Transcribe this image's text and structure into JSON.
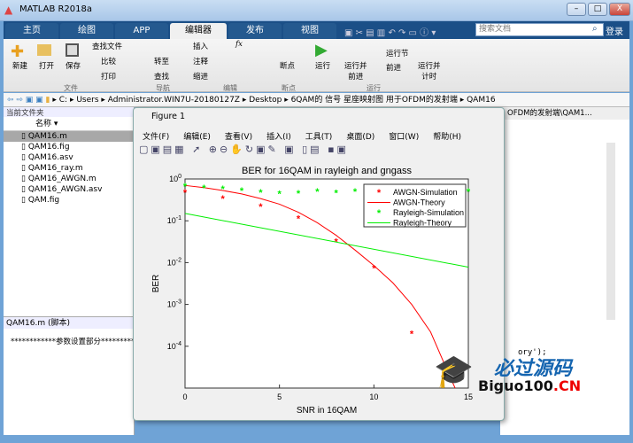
{
  "window": {
    "title": "MATLAB R2018a",
    "min": "–",
    "max": "□",
    "close": "X"
  },
  "tabs": [
    {
      "label": "主页"
    },
    {
      "label": "绘图"
    },
    {
      "label": "APP"
    },
    {
      "label": "编辑器"
    },
    {
      "label": "发布"
    },
    {
      "label": "视图"
    }
  ],
  "search": {
    "placeholder": "搜索文档"
  },
  "login": "登录",
  "ribbon": {
    "new": "新建",
    "open": "打开",
    "save": "保存",
    "find_files": "查找文件",
    "compare": "比较",
    "print": "打印",
    "goto": "转至",
    "find": "查找",
    "insert": "插入",
    "comment": "注释",
    "indent": "缩进",
    "fx": "fx",
    "breakpoints": "断点",
    "run": "运行",
    "run_advance": "运行并\n前进",
    "run_section": "运行节",
    "advance": "前进",
    "run_time": "运行并\n计时",
    "groups": {
      "file": "文件",
      "nav": "导航",
      "edit": "编辑",
      "bp": "断点",
      "run": "运行"
    }
  },
  "address": {
    "path": [
      "C:",
      "Users",
      "Administrator.WIN7U-20180127Z",
      "Desktop",
      "6QAM的 信号 星座映射图 用于OFDM的发射端",
      "QAM16"
    ]
  },
  "current_folder": {
    "title": "当前文件夹",
    "column": "名称",
    "files": [
      {
        "name": "QAM16.m",
        "selected": true
      },
      {
        "name": "QAM16.fig"
      },
      {
        "name": "QAM16.asv"
      },
      {
        "name": "QAM16_ray.m"
      },
      {
        "name": "QAM16_AWGN.m"
      },
      {
        "name": "QAM16_AWGN.asv"
      },
      {
        "name": "QAM.fig"
      }
    ]
  },
  "details": {
    "title": "QAM16.m  (脚本)",
    "text": "************参数设置部分***********"
  },
  "editor": {
    "tab": "OFDM的发射端\\QAM1...",
    "code_fragment": "ory');"
  },
  "figure": {
    "title": "Figure 1",
    "menu": [
      "文件(F)",
      "编辑(E)",
      "查看(V)",
      "插入(I)",
      "工具(T)",
      "桌面(D)",
      "窗口(W)",
      "帮助(H)"
    ]
  },
  "watermark": {
    "cn": "必过源码",
    "en": "Biguo100",
    ".cn": ".CN"
  },
  "chart_data": {
    "type": "line",
    "title": "BER for 16QAM in rayleigh and gngass",
    "xlabel": "SNR in 16QAM",
    "ylabel": "BER",
    "xlim": [
      0,
      15
    ],
    "ylim": [
      1e-05,
      1
    ],
    "yscale": "log",
    "xticks": [
      0,
      5,
      10,
      15
    ],
    "yticks": [
      "10^0",
      "10^-1",
      "10^-2",
      "10^-3",
      "10^-4"
    ],
    "legend_position": "top-right",
    "series": [
      {
        "name": "AWGN-Simulation",
        "style": "marker",
        "color": "#ff0000",
        "x": [
          0,
          2,
          4,
          6,
          8,
          10,
          12
        ],
        "y": [
          0.48,
          0.34,
          0.22,
          0.115,
          0.032,
          0.0075,
          0.0002
        ]
      },
      {
        "name": "AWGN-Theory",
        "style": "line",
        "color": "#ff0000",
        "x": [
          0,
          1,
          2,
          3,
          4,
          5,
          6,
          7,
          8,
          9,
          10,
          11,
          12,
          13,
          14,
          14.3
        ],
        "y": [
          0.7,
          0.62,
          0.53,
          0.44,
          0.34,
          0.25,
          0.16,
          0.09,
          0.045,
          0.02,
          0.0085,
          0.0033,
          0.001,
          0.00022,
          2e-05,
          1e-05
        ]
      },
      {
        "name": "Rayleigh-Simulation",
        "style": "marker",
        "color": "#00ee00",
        "x": [
          0,
          1,
          2,
          3,
          4,
          5,
          6,
          7,
          8,
          9,
          10,
          11,
          12,
          13,
          14,
          15
        ],
        "y": [
          0.67,
          0.62,
          0.58,
          0.53,
          0.48,
          0.45,
          0.46,
          0.5,
          0.47,
          0.5,
          0.5,
          0.5,
          0.5,
          0.5,
          0.5,
          0.5
        ]
      },
      {
        "name": "Rayleigh-Theory",
        "style": "line",
        "color": "#00ee00",
        "x": [
          0,
          15
        ],
        "y": [
          0.15,
          0.0078
        ]
      }
    ]
  }
}
